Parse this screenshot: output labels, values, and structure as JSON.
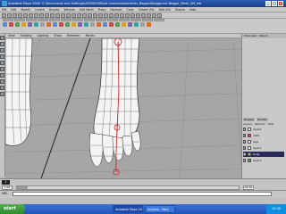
{
  "window": {
    "title": "Autodesk Maya 2008: C:\\Documents and Settings\\LEE\\MOUSE\\pie humanos\\elements_Beggar\\Beggar.ma  Beggar_Mesh_SM_mb",
    "minimize": "_",
    "maximize": "□",
    "close": "×"
  },
  "menu": [
    "File",
    "Edit",
    "Modify",
    "Create",
    "Display",
    "Window",
    "Edit Mesh",
    "Proxy",
    "Normals",
    "Color",
    "Create UVs",
    "Edit UVs",
    "Muscle",
    "Help"
  ],
  "panel_menu": [
    "View",
    "Shading",
    "Lighting",
    "Show",
    "Renderer",
    "Panels"
  ],
  "channel_box": {
    "header": [
      "Channels",
      "Object"
    ],
    "tabs": [
      "Display",
      "Render"
    ]
  },
  "layers": {
    "menu": [
      "Layers",
      "Options",
      "Help"
    ],
    "items": [
      {
        "name": "layer4",
        "color": "#f0f0f0",
        "visible": "V"
      },
      {
        "name": "cloth",
        "color": "#d04040",
        "visible": "V"
      },
      {
        "name": "legs",
        "color": "#f0f0f0",
        "visible": "V"
      },
      {
        "name": "layer1",
        "color": "#f0f0f0",
        "visible": "V"
      },
      {
        "name": "body",
        "color": "#c0c040",
        "visible": "V"
      },
      {
        "name": "layer3",
        "color": "#40a040",
        "visible": "V"
      }
    ]
  },
  "timeline": {
    "current_frame": "1",
    "range_start": "1.00",
    "range_end": "24.00"
  },
  "command": {
    "label": "MEL"
  },
  "taskbar": {
    "start": "start",
    "tasks": [
      "Autodesk Maya 2008",
      "Untitled - Paint"
    ],
    "clock": "12:00"
  },
  "colors": {
    "viewport_bg": "#a6a6a6",
    "mesh_fill": "#f4f4f4",
    "wireframe": "#2e2e2e",
    "joint": "#cc2222",
    "xp_blue": "#2454b8"
  }
}
